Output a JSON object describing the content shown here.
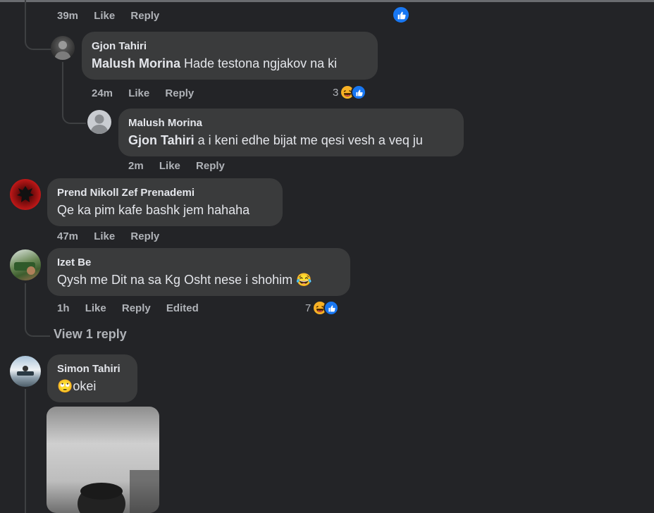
{
  "colors": {
    "background": "#232427",
    "bubble": "#3a3b3c",
    "meta_text": "#b0b3b8",
    "primary_text": "#e4e6eb",
    "like_blue": "#1877f2",
    "haha_yellow": "#f7b125"
  },
  "top_fragment": {
    "time": "39m",
    "like_label": "Like",
    "reply_label": "Reply",
    "reaction_icon": "like-icon"
  },
  "comments": [
    {
      "author": "Gjon Tahiri",
      "mention": "Malush Morina",
      "text": " Hade testona ngjakov na ki",
      "time": "24m",
      "like_label": "Like",
      "reply_label": "Reply",
      "reaction_count": "3",
      "reaction_icons": [
        "haha-icon",
        "like-icon"
      ]
    },
    {
      "author": "Malush Morina",
      "mention": "Gjon Tahiri",
      "text": " a i keni edhe bijat me qesi vesh a veq ju",
      "time": "2m",
      "like_label": "Like",
      "reply_label": "Reply"
    },
    {
      "author": "Prend Nikoll Zef Prenademi",
      "text": "Qe ka pim kafe bashk jem hahaha",
      "time": "47m",
      "like_label": "Like",
      "reply_label": "Reply"
    },
    {
      "author": "Izet Be",
      "text": "Qysh me Dit na sa Kg Osht nese i shohim 😂",
      "time": "1h",
      "like_label": "Like",
      "reply_label": "Reply",
      "edited_label": "Edited",
      "reaction_count": "7",
      "reaction_icons": [
        "haha-icon",
        "like-icon"
      ],
      "view_replies": "View 1 reply"
    },
    {
      "author": "Simon Tahiri",
      "text": "🙄okei",
      "attachment": "photo-attachment"
    }
  ]
}
